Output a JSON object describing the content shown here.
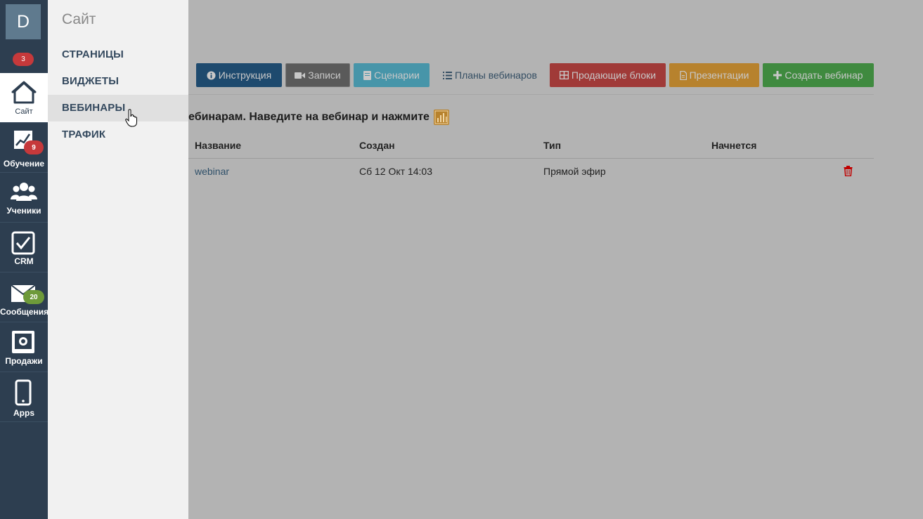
{
  "rail": {
    "avatar_letter": "D",
    "top_badge": "3",
    "items": [
      {
        "label": "Сайт",
        "icon": "home-icon",
        "active": true
      },
      {
        "label": "Обучение",
        "icon": "chart-growth-icon",
        "badge": "9",
        "badge_color": "#c6393b"
      },
      {
        "label": "Ученики",
        "icon": "users-icon"
      },
      {
        "label": "CRM",
        "icon": "checkbox-icon"
      },
      {
        "label": "Сообщения",
        "icon": "envelope-icon",
        "badge": "20",
        "badge_color": "#6e9a3a"
      },
      {
        "label": "Продажи",
        "icon": "safe-icon"
      },
      {
        "label": "Apps",
        "icon": "phone-icon"
      }
    ]
  },
  "flyout": {
    "title": "Сайт",
    "items": [
      "СТРАНИЦЫ",
      "ВИДЖЕТЫ",
      "ВЕБИНАРЫ",
      "ТРАФИК"
    ],
    "hovered": "ВЕБИНАРЫ"
  },
  "toolbar": {
    "buttons": [
      {
        "label": "Инструкция",
        "icon": "info-circle-icon",
        "color": "#1e4a6e"
      },
      {
        "label": "Записи",
        "icon": "video-camera-icon",
        "color": "#5a5a5a"
      },
      {
        "label": "Сценарии",
        "icon": "book-icon",
        "color": "#4795a9"
      },
      {
        "label": "Планы вебинаров",
        "icon": "list-icon",
        "color": "link"
      },
      {
        "label": "Продающие блоки",
        "icon": "grid-icon",
        "color": "#a03a38"
      },
      {
        "label": "Презентации",
        "icon": "file-icon",
        "color": "#b7822d"
      },
      {
        "label": "Создать вебинар",
        "icon": "plus-icon",
        "color": "#3f8a3f"
      }
    ]
  },
  "hint": {
    "text": "ебинарам. Наведите на вебинар и нажмите",
    "icon": "bar-chart-icon"
  },
  "table": {
    "headers": [
      "Название",
      "Создан",
      "Тип",
      "Начнется"
    ],
    "rows": [
      {
        "name": "webinar",
        "created": "Сб 12 Окт 14:03",
        "type": "Прямой эфир",
        "starts": ""
      }
    ]
  },
  "colors": {
    "rail_bg": "#2d3e50",
    "overlay_bg": "#b3b3b3",
    "trash_red": "#c00000",
    "chart_icon_orange": "#b7822d"
  }
}
